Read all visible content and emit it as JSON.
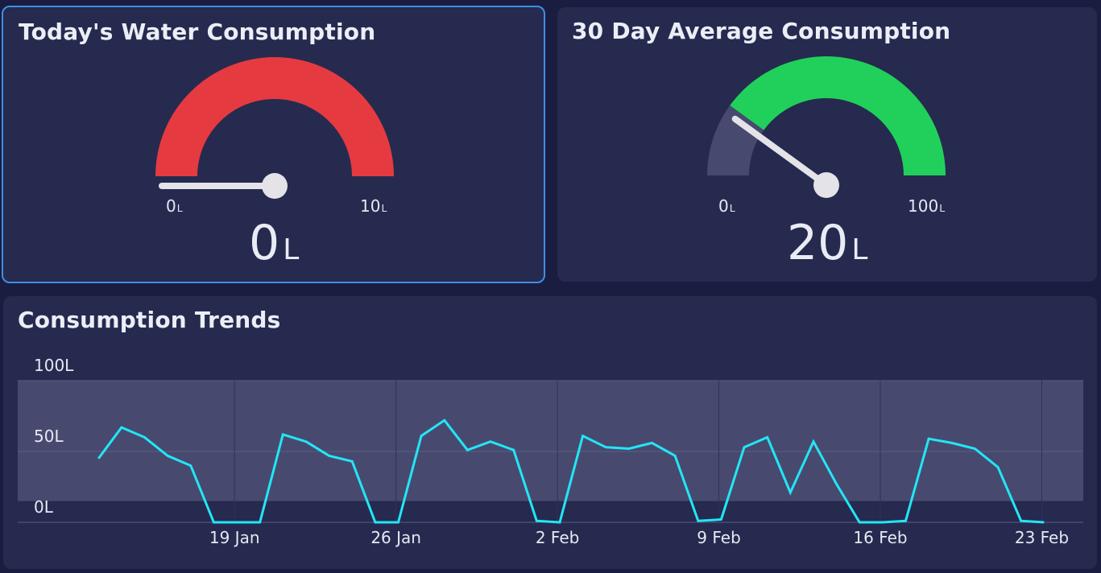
{
  "colors": {
    "background": "#1a1d40",
    "card": "#262a4f",
    "selected_border": "#3d8fe6",
    "gauge_red": "#e63a41",
    "gauge_green": "#21d05a",
    "gauge_track": "#474a6e",
    "needle": "#e3e3e8",
    "trend_line": "#22e6f7",
    "trend_band": "#474a6e"
  },
  "today": {
    "title": "Today's Water Consumption",
    "value": 0,
    "value_text": "0",
    "unit": "L",
    "min_text": "0",
    "max_text": "10",
    "min": 0,
    "max": 10,
    "color": "red"
  },
  "average": {
    "title": "30 Day Average Consumption",
    "value": 20,
    "value_text": "20",
    "unit": "L",
    "min_text": "0",
    "max_text": "100",
    "min": 0,
    "max": 100,
    "color": "green"
  },
  "trends": {
    "title": "Consumption Trends",
    "chart_data": {
      "type": "line",
      "title": "Consumption Trends",
      "y_tick_labels": [
        "100L",
        "50L",
        "0L"
      ],
      "y_ticks": [
        100,
        50,
        0
      ],
      "ylim": [
        0,
        100
      ],
      "band": [
        15,
        100
      ],
      "x_tick_labels": [
        "19 Jan",
        "26 Jan",
        "2 Feb",
        "9 Feb",
        "16 Feb",
        "23 Feb"
      ],
      "x_tick_days": [
        7,
        14,
        21,
        28,
        35,
        42
      ],
      "x_range_days": [
        -2.4,
        43.8
      ],
      "start_day": 1.1,
      "grid": true,
      "values": [
        45,
        67,
        60,
        47,
        40,
        0,
        0,
        0,
        62,
        57,
        47,
        43,
        0,
        0,
        61,
        72,
        51,
        57,
        51,
        1,
        0,
        61,
        53,
        52,
        56,
        47,
        1,
        2,
        53,
        60,
        21,
        57,
        27,
        0,
        0,
        1,
        59,
        56,
        52,
        39,
        1,
        0
      ]
    }
  }
}
